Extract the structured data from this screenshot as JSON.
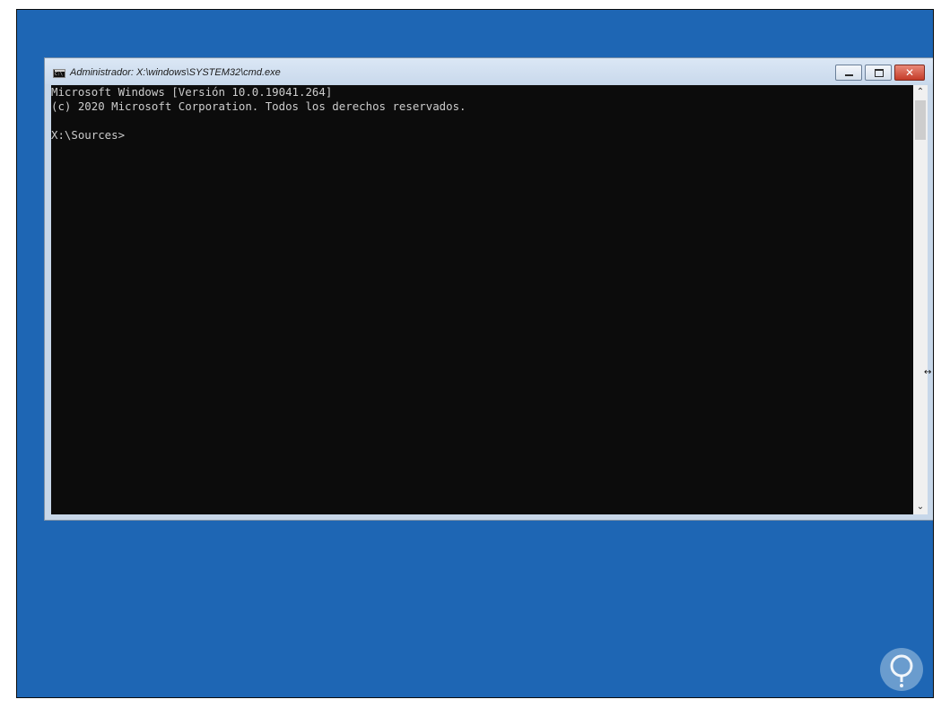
{
  "window": {
    "title": "Administrador: X:\\windows\\SYSTEM32\\cmd.exe",
    "buttons": {
      "minimize": "",
      "maximize": "",
      "close": "✕"
    }
  },
  "console": {
    "lines": [
      "Microsoft Windows [Versión 10.0.19041.264]",
      "(c) 2020 Microsoft Corporation. Todos los derechos reservados.",
      "",
      "X:\\Sources>"
    ]
  },
  "scrollbar": {
    "up_arrow": "⌃",
    "down_arrow": "⌄"
  },
  "colors": {
    "desktop": "#1e66b4",
    "console_bg": "#0c0c0c",
    "console_text": "#cccccc",
    "close_button": "#c43b28"
  }
}
